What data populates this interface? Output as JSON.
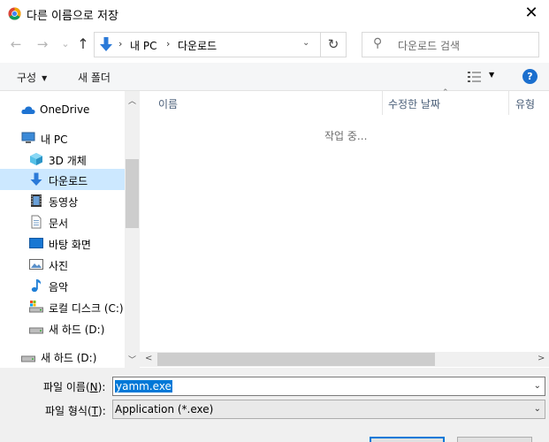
{
  "window": {
    "title": "다른 이름으로 저장",
    "close": "✕"
  },
  "nav": {
    "back": "←",
    "forward": "→",
    "recent": "⌄",
    "up": "↑",
    "address": {
      "parts": [
        "내 PC",
        "다운로드"
      ],
      "separator": "›",
      "dropdown": "⌄"
    },
    "refresh": "↻",
    "search_placeholder": "다운로드 검색",
    "search_icon": "search-icon"
  },
  "toolbar": {
    "organize": "구성",
    "organize_caret": "▼",
    "new_folder": "새 폴더",
    "view_caret": "▼",
    "help": "?"
  },
  "sidebar": {
    "items": [
      {
        "label": "OneDrive",
        "icon": "onedrive-icon"
      },
      {
        "label": "내 PC",
        "icon": "pc-icon"
      },
      {
        "label": "3D 개체",
        "icon": "3d-objects-icon"
      },
      {
        "label": "다운로드",
        "icon": "download-icon",
        "selected": true
      },
      {
        "label": "동영상",
        "icon": "video-icon"
      },
      {
        "label": "문서",
        "icon": "document-icon"
      },
      {
        "label": "바탕 화면",
        "icon": "desktop-icon"
      },
      {
        "label": "사진",
        "icon": "pictures-icon"
      },
      {
        "label": "음악",
        "icon": "music-icon"
      },
      {
        "label": "로컬 디스크 (C:)",
        "icon": "local-disk-icon"
      },
      {
        "label": "새 하드 (D:)",
        "icon": "drive-icon"
      },
      {
        "label": "새 하드 (D:)",
        "icon": "drive-icon"
      }
    ],
    "scroll_up": "︿",
    "scroll_down": "﹀"
  },
  "filelist": {
    "columns": [
      "이름",
      "수정한 날짜",
      "유형"
    ],
    "sort_indicator": "⌃",
    "status": "작업 중...",
    "scroll_left": "<",
    "scroll_right": ">"
  },
  "form": {
    "filename_label": "파일 이름(",
    "filename_key": "N",
    "filename_label_end": "):",
    "filename_value": "yamm.exe",
    "filetype_label": "파일 형식(",
    "filetype_key": "T",
    "filetype_label_end": "):",
    "filetype_value": "Application (*.exe)",
    "caret": "⌄"
  },
  "colors": {
    "accent": "#0078d7",
    "selected_bg": "#cce8ff",
    "toolbar_bg": "#f5f6f7",
    "bottom_bg": "#f0f0f0"
  }
}
